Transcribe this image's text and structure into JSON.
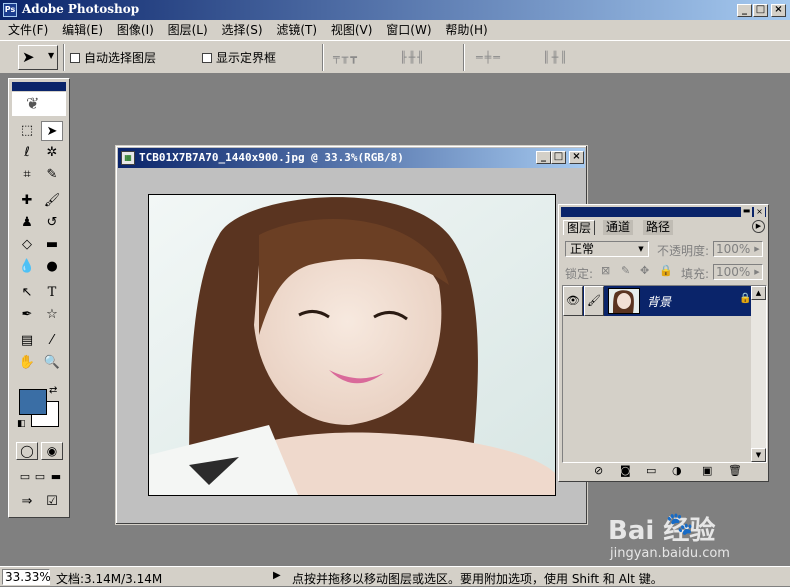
{
  "app": {
    "title": "Adobe Photoshop",
    "window_buttons": [
      "_",
      "□",
      "×"
    ]
  },
  "menu": [
    "文件(F)",
    "编辑(E)",
    "图像(I)",
    "图层(L)",
    "选择(S)",
    "滤镜(T)",
    "视图(V)",
    "窗口(W)",
    "帮助(H)"
  ],
  "options_bar": {
    "auto_select_label": "自动选择图层",
    "show_bounds_label": "显示定界框"
  },
  "document": {
    "title": "TCB01X7B7A70_1440x900.jpg @ 33.3%(RGB/8)"
  },
  "colors": {
    "foreground": "#3a6ea5",
    "background": "#ffffff",
    "titlebar_active": "#0a246a",
    "workspace": "#808080"
  },
  "layers_panel": {
    "tabs": [
      "图层",
      "通道",
      "路径"
    ],
    "blend_mode": "正常",
    "opacity_label": "不透明度:",
    "opacity_value": "100%",
    "lock_label": "锁定:",
    "fill_label": "填充:",
    "fill_value": "100%",
    "layer_name": "背景"
  },
  "status_bar": {
    "zoom": "33.33%",
    "doc_size": "文档:3.14M/3.14M",
    "hint": "点按并拖移以移动图层或选区。要用附加选项，使用 Shift 和 Alt 键。"
  },
  "watermark": {
    "text": "jingyan.baidu.com",
    "logo": "Bai 经验"
  }
}
